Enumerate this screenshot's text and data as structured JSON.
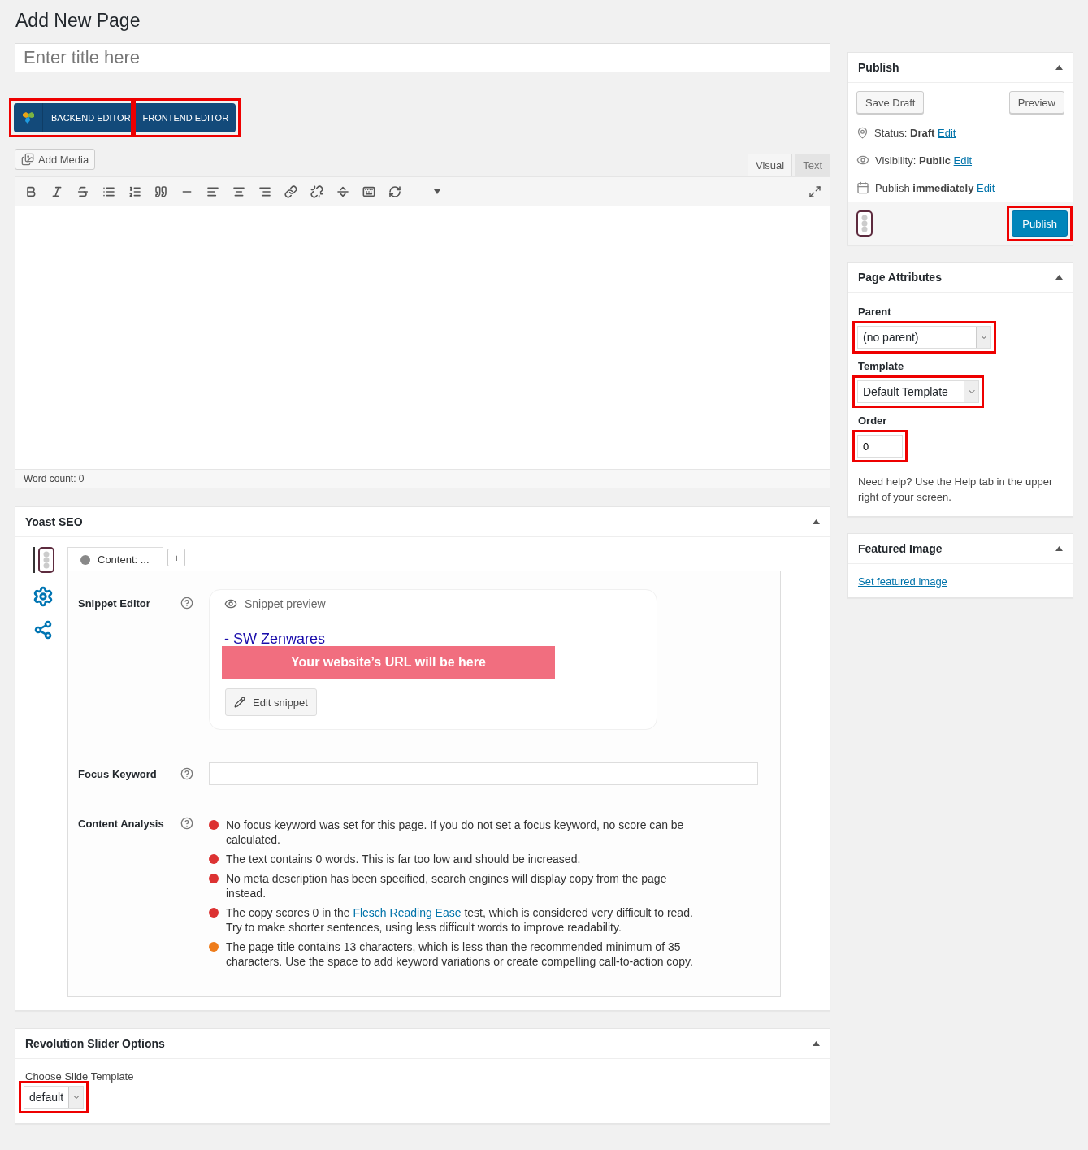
{
  "page_title": "Add New Page",
  "title_field": {
    "placeholder": "Enter title here"
  },
  "editor_switch": [
    {
      "label": "BACKEND EDITOR",
      "kind": "backend",
      "highlighted": true
    },
    {
      "label": "FRONTEND EDITOR",
      "kind": "frontend",
      "highlighted": true
    }
  ],
  "add_media": "Add Media",
  "editor_tabs": [
    {
      "label": "Visual",
      "selected": true
    },
    {
      "label": "Text",
      "selected": false
    }
  ],
  "word_count": "Word count: 0",
  "yoast": {
    "title": "Yoast SEO",
    "content_tab": "Content: ...",
    "add_tab": "+",
    "snippet_label": "Snippet Editor",
    "snippet_preview": "Snippet preview",
    "snippet_title": "- SW Zenwares",
    "url_text": "Your website’s URL will be here",
    "edit_snippet": "Edit snippet",
    "focus_label": "Focus Keyword",
    "analysis_label": "Content Analysis",
    "analysis": [
      {
        "color": "#dc3232",
        "text": "No focus keyword was set for this page. If you do not set a focus keyword, no score can be calculated."
      },
      {
        "color": "#dc3232",
        "text": "The text contains 0 words. This is far too low and should be increased."
      },
      {
        "color": "#dc3232",
        "text": "No meta description has been specified, search engines will display copy from the page instead."
      },
      {
        "color": "#dc3232",
        "text": "The copy scores 0 in the ",
        "link": "Flesch Reading Ease",
        "after": " test, which is considered very difficult to read. Try to make shorter sentences, using less difficult words to improve readability."
      },
      {
        "color": "#ee7c1b",
        "text": "The page title contains 13 characters, which is less than the recommended minimum of 35 characters. Use the space to add keyword variations or create compelling call-to-action copy."
      }
    ]
  },
  "revslider": {
    "title": "Revolution Slider Options",
    "label": "Choose Slide Template",
    "select": {
      "value": "default",
      "highlighted": true
    }
  },
  "publish": {
    "title": "Publish",
    "save_draft": "Save Draft",
    "preview": "Preview",
    "rows": [
      {
        "kind": "status",
        "label": "Status:",
        "value": "Draft",
        "link": "Edit"
      },
      {
        "kind": "visibility",
        "label": "Visibility:",
        "value": "Public",
        "link": "Edit"
      },
      {
        "kind": "schedule",
        "label": "Publish",
        "value": "immediately",
        "link": "Edit"
      }
    ],
    "button": {
      "label": "Publish",
      "highlighted": true
    }
  },
  "page_attributes": {
    "title": "Page Attributes",
    "parent_label": "Parent",
    "parent": {
      "value": "(no parent)",
      "highlighted": true
    },
    "template_label": "Template",
    "template": {
      "value": "Default Template",
      "highlighted": true
    },
    "order_label": "Order",
    "order": {
      "value": "0",
      "highlighted": true
    },
    "help": "Need help? Use the Help tab in the upper right of your screen."
  },
  "featured_image": {
    "title": "Featured Image",
    "link": "Set featured image"
  }
}
